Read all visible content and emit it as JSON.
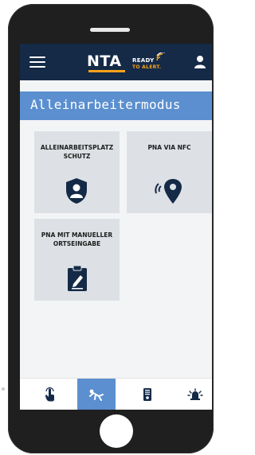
{
  "app": {
    "logo_main": "NTA",
    "logo_ready": "READY",
    "logo_alert": "TO ALERT."
  },
  "header": {
    "title": "Alleinarbeitermodus"
  },
  "tiles": [
    {
      "label": "ALLEINARBEITSPLATZ SCHUTZ",
      "icon": "shield-user-icon"
    },
    {
      "label": "PNA VIA NFC",
      "icon": "nfc-location-icon"
    },
    {
      "label": "PNA MIT MANUELLER ORTSEINGABE",
      "icon": "clipboard-edit-icon"
    }
  ],
  "bottom_nav": [
    {
      "icon": "touch-icon",
      "active": false
    },
    {
      "icon": "man-down-icon",
      "active": true
    },
    {
      "icon": "device-icon",
      "active": false
    },
    {
      "icon": "alarm-icon",
      "active": false
    }
  ],
  "colors": {
    "topbar": "#142a47",
    "accent": "#5b8fcf",
    "brand_orange": "#f7a21b",
    "tile": "#dde1e5"
  }
}
